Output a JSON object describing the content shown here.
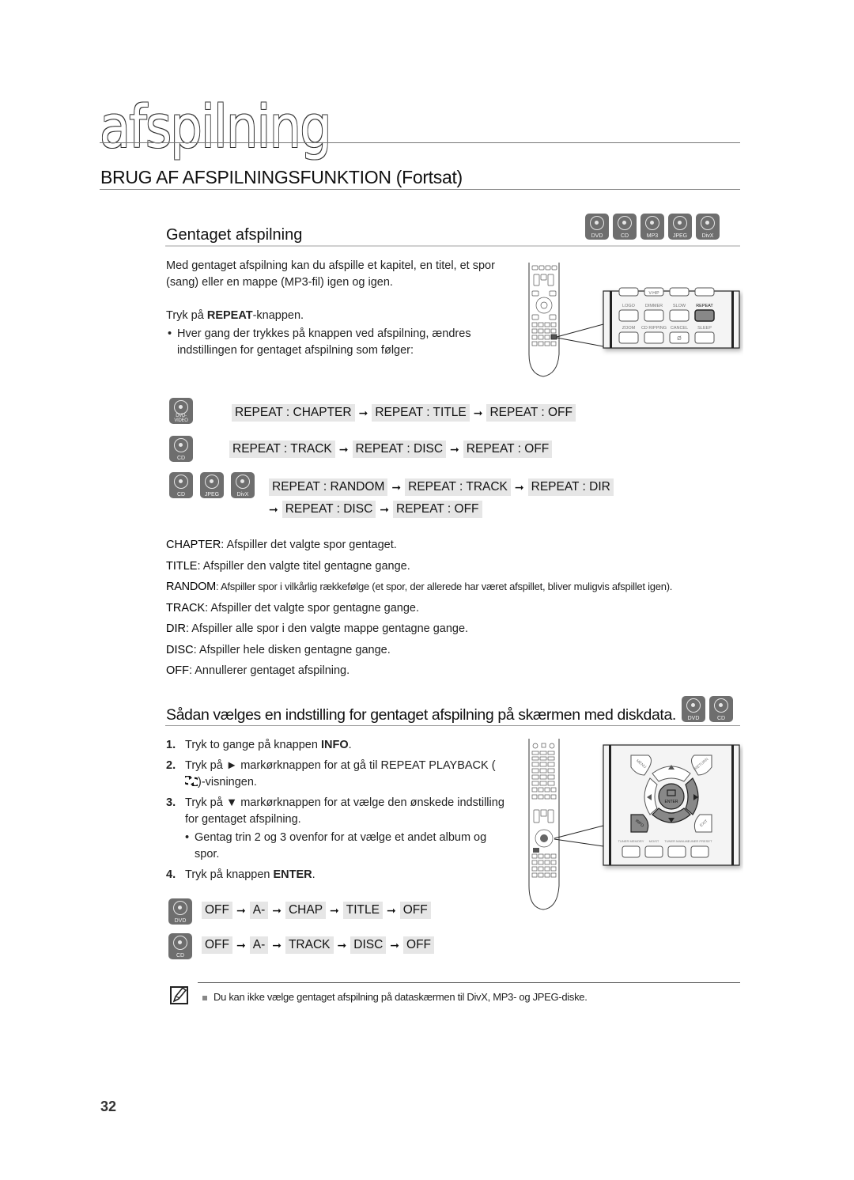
{
  "chapter": "afspilning",
  "section_title": "BRUG AF AFSPILNINGSFUNKTION (Fortsat)",
  "section1": {
    "title": "Gentaget afspilning",
    "disc_icons": [
      "DVD",
      "CD",
      "MP3",
      "JPEG",
      "DivX"
    ],
    "intro": "Med gentaget afspilning kan du afspille et kapitel, en titel, et spor (sang) eller en mappe (MP3-fil) igen og igen.",
    "press_prefix": "Tryk på ",
    "press_key": "REPEAT",
    "press_suffix": "-knappen.",
    "bullet": "Hver gang der trykkes på knappen ved afspilning, ændres indstillingen for gentaget afspilning som følger:",
    "remote_keys": {
      "row1": [
        "LOGO",
        "DIMMER",
        "SLOW",
        "REPEAT"
      ],
      "row2": [
        "ZOOM",
        "CD RIPPING",
        "CANCEL",
        "SLEEP"
      ],
      "top_label": "V-H/P",
      "cancel_glyph": "Ø"
    },
    "sequences": [
      {
        "discs": [
          "DVD-VIDEO"
        ],
        "steps": [
          "REPEAT : CHAPTER",
          "REPEAT : TITLE",
          "REPEAT : OFF"
        ]
      },
      {
        "discs": [
          "CD"
        ],
        "steps": [
          "REPEAT : TRACK",
          "REPEAT : DISC",
          "REPEAT : OFF"
        ]
      },
      {
        "discs": [
          "CD",
          "JPEG",
          "DivX"
        ],
        "steps": [
          "REPEAT : RANDOM",
          "REPEAT : TRACK",
          "REPEAT : DIR",
          "REPEAT : DISC",
          "REPEAT : OFF"
        ]
      }
    ],
    "definitions": [
      {
        "term": "CHAPTER",
        "text": ": Afspiller det valgte spor gentaget."
      },
      {
        "term": "TITLE",
        "text": ": Afspiller den valgte titel gentagne gange."
      },
      {
        "term": "RANDOM",
        "text": ": Afspiller spor i vilkårlig rækkefølge (et spor, der allerede har været afspillet, bliver muligvis afspillet igen)."
      },
      {
        "term": "TRACK",
        "text": ": Afspiller det valgte spor gentagne gange."
      },
      {
        "term": "DIR",
        "text": ": Afspiller alle spor i den valgte mappe gentagne gange."
      },
      {
        "term": "DISC",
        "text": ": Afspiller hele disken gentagne gange."
      },
      {
        "term": "OFF",
        "text": ": Annullerer gentaget afspilning."
      }
    ]
  },
  "section2": {
    "title": "Sådan vælges en indstilling for gentaget afspilning på skærmen med diskdata.",
    "disc_icons": [
      "DVD",
      "CD"
    ],
    "steps": [
      {
        "n": "1.",
        "pre": "Tryk to gange på knappen ",
        "key": "INFO",
        "post": "."
      },
      {
        "n": "2.",
        "pre": "Tryk på ► markørknappen for at gå til REPEAT PLAYBACK (",
        "key": "",
        "post": ")-visningen.",
        "icon": "repeat-icon"
      },
      {
        "n": "3.",
        "pre": "Tryk på ▼ markørknappen for at vælge den ønskede indstilling for gentaget afspilning.",
        "key": "",
        "post": "",
        "sub": "Gentag trin 2 og 3 ovenfor for at vælge et andet album og spor."
      },
      {
        "n": "4.",
        "pre": "Tryk på knappen ",
        "key": "ENTER",
        "post": "."
      }
    ],
    "remote_keys": {
      "menu": "MENU",
      "return": "RETURN",
      "enter": "ENTER",
      "info": "INFO",
      "exit": "EXIT",
      "bottom": [
        "TUNER MEMORY",
        "MO/ST",
        "TUNER MANUAL",
        "TUNER PRESET"
      ]
    },
    "sequences": [
      {
        "discs": [
          "DVD"
        ],
        "steps": [
          "OFF",
          "A-",
          "CHAP",
          "TITLE",
          "OFF"
        ]
      },
      {
        "discs": [
          "CD"
        ],
        "steps": [
          "OFF",
          "A-",
          "TRACK",
          "DISC",
          "OFF"
        ]
      }
    ]
  },
  "note": "Du kan ikke vælge gentaget afspilning på dataskærmen til DivX, MP3- og JPEG-diske.",
  "page_number": "32",
  "arrow": "➞"
}
